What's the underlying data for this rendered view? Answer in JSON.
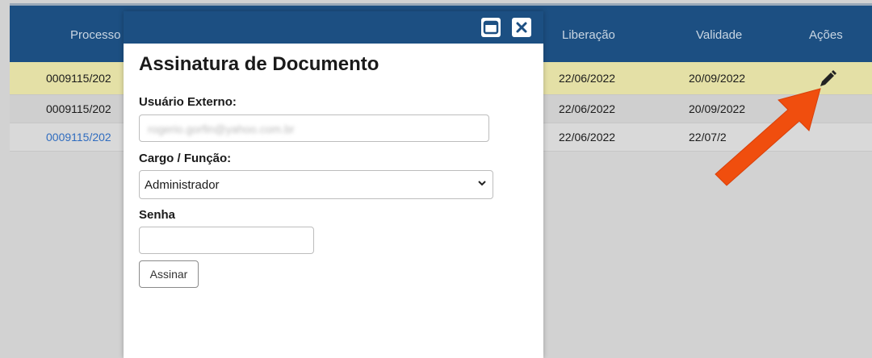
{
  "table": {
    "headers": {
      "processo": "Processo",
      "liberacao": "Liberação",
      "validade": "Validade",
      "acoes": "Ações"
    },
    "rows": [
      {
        "processo": "0009115/202",
        "liberacao": "22/06/2022",
        "validade": "20/09/2022",
        "highlight": true,
        "action_icon": "pencil-icon"
      },
      {
        "processo": "0009115/202",
        "liberacao": "22/06/2022",
        "validade": "20/09/2022"
      },
      {
        "processo": "0009115/202",
        "liberacao": "22/06/2022",
        "validade": "22/07/2",
        "link": true
      }
    ]
  },
  "modal": {
    "title": "Assinatura de Documento",
    "controls": [
      "maximize-icon",
      "close-icon"
    ],
    "fields": {
      "usuario_label": "Usuário Externo:",
      "usuario_value": "rogerio.gorfin@yahoo.com.br",
      "cargo_label": "Cargo / Função:",
      "cargo_value": "Administrador",
      "senha_label": "Senha",
      "senha_value": ""
    },
    "submit_label": "Assinar"
  },
  "annotation": {
    "icon": "arrow-icon",
    "color": "#f04e0e"
  },
  "colors": {
    "header": "#1c4f82",
    "highlight_row": "#e4e0a6",
    "link": "#2f6cbf"
  }
}
